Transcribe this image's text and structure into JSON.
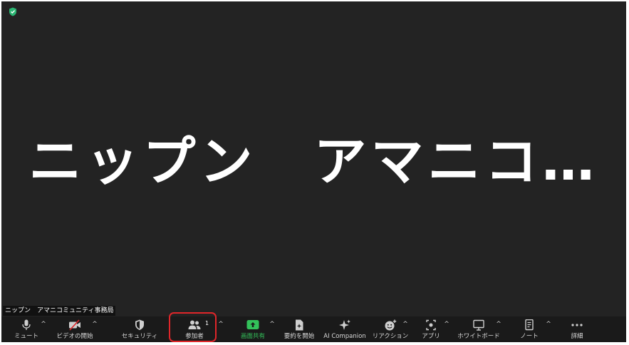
{
  "meeting": {
    "participant_display": "ニップン　アマニコ…",
    "name_tag": "ニップン　アマニコミュニティ事務局"
  },
  "toolbar": {
    "mute": {
      "label": "ミュート",
      "icon": "microphone-icon"
    },
    "video": {
      "label": "ビデオの開始",
      "icon": "video-off-icon"
    },
    "security": {
      "label": "セキュリティ",
      "icon": "shield-icon"
    },
    "participants": {
      "label": "参加者",
      "icon": "participants-icon",
      "count": "1"
    },
    "share": {
      "label": "画面共有",
      "icon": "share-screen-icon"
    },
    "summary": {
      "label": "要約を開始",
      "icon": "document-sparkle-icon"
    },
    "ai": {
      "label": "AI Companion",
      "icon": "sparkle-icon"
    },
    "reactions": {
      "label": "リアクション",
      "icon": "emoji-plus-icon"
    },
    "apps": {
      "label": "アプリ",
      "icon": "apps-icon"
    },
    "whiteboard": {
      "label": "ホワイトボード",
      "icon": "whiteboard-icon"
    },
    "notes": {
      "label": "ノート",
      "icon": "notes-icon"
    },
    "more": {
      "label": "詳細",
      "icon": "more-dots-icon"
    }
  },
  "colors": {
    "background": "#232323",
    "toolbar": "#1a1a1a",
    "share_accent": "#33c25a",
    "highlight": "#e0262a",
    "encryption_shield": "#2bb673"
  }
}
